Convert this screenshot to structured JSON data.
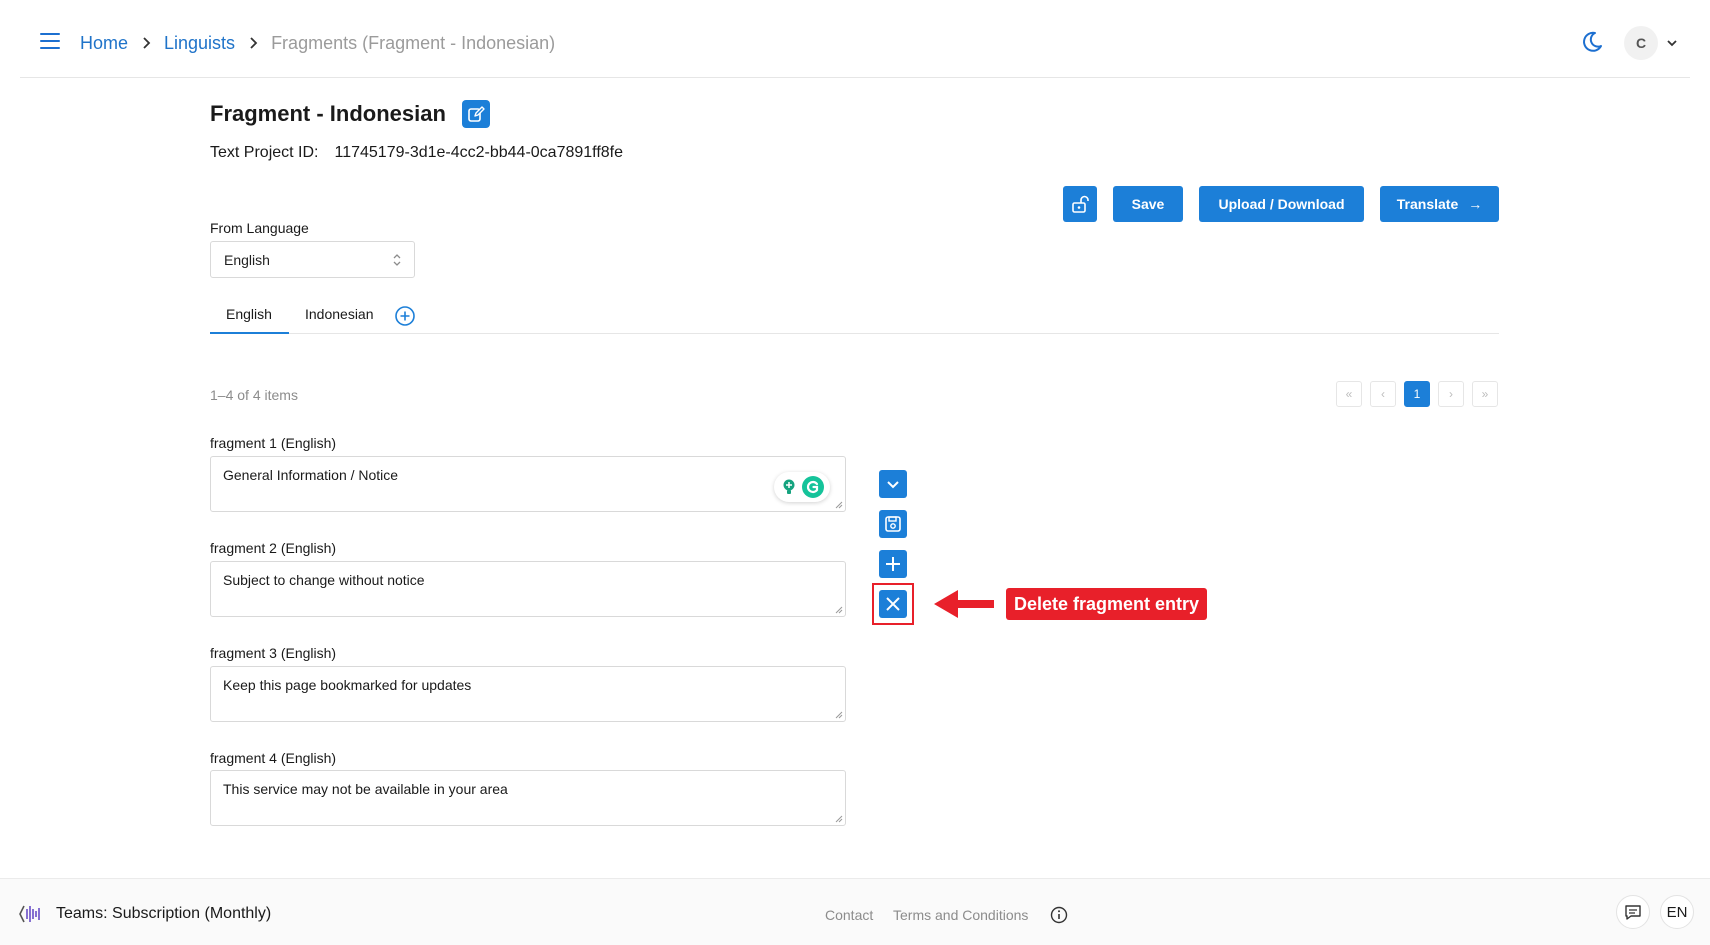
{
  "breadcrumb": {
    "home": "Home",
    "linguists": "Linguists",
    "current": "Fragments (Fragment - Indonesian)"
  },
  "user": {
    "initial": "C"
  },
  "title": "Fragment - Indonesian",
  "project": {
    "label": "Text Project ID:",
    "id": "11745179-3d1e-4cc2-bb44-0ca7891ff8fe"
  },
  "actions": {
    "save": "Save",
    "upload_download": "Upload / Download",
    "translate": "Translate",
    "translate_arrow": "→"
  },
  "from_language": {
    "label": "From Language",
    "value": "English"
  },
  "tabs": [
    {
      "label": "English",
      "active": true
    },
    {
      "label": "Indonesian",
      "active": false
    }
  ],
  "pagination": {
    "summary": "1–4 of 4 items",
    "first": "«",
    "prev": "‹",
    "current": "1",
    "next": "›",
    "last": "»"
  },
  "fragments": [
    {
      "label": "fragment 1 (English)",
      "value": "General Information / Notice"
    },
    {
      "label": "fragment 2 (English)",
      "value": "Subject to change without notice"
    },
    {
      "label": "fragment 3 (English)",
      "value": "Keep this page bookmarked for updates"
    },
    {
      "label": "fragment 4 (English)",
      "value": "This service may not be available in your area"
    }
  ],
  "annotation": {
    "text": "Delete fragment entry",
    "color": "#e8202a"
  },
  "footer": {
    "plan": "Teams: Subscription (Monthly)",
    "contact": "Contact",
    "terms": "Terms and Conditions",
    "language": "EN"
  },
  "colors": {
    "primary": "#1c7fd8",
    "link": "#1f73c9",
    "muted": "#9b9b9b"
  },
  "icons": {
    "menu": "hamburger-icon",
    "theme": "moon-icon",
    "edit": "edit-icon",
    "lock": "unlock-icon",
    "add_tab": "plus-circle-icon",
    "expand": "chevron-down-icon",
    "save_fragment": "save-icon",
    "add_fragment": "plus-icon",
    "delete_fragment": "close-icon",
    "info": "info-icon",
    "chat": "chat-icon"
  }
}
